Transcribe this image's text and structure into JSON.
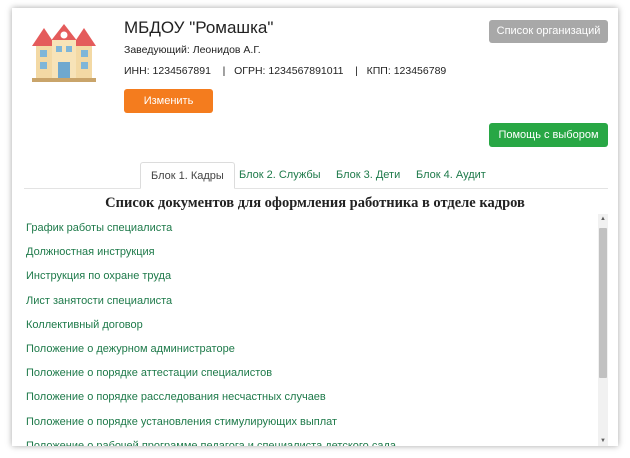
{
  "org": {
    "name": "МБДОУ \"Ромашка\"",
    "director": "Заведующий: Леонидов А.Г.",
    "ids": "ИНН: 1234567891    |   ОГРН: 1234567891011    |   КПП: 123456789"
  },
  "buttons": {
    "edit": "Изменить",
    "org_list": "Список организаций",
    "help": "Помощь с выбором"
  },
  "tabs": [
    "Блок 1. Кадры",
    "Блок 2. Службы",
    "Блок 3. Дети",
    "Блок 4. Аудит"
  ],
  "active_tab": "Блок 1. Кадры",
  "list_title": "Список документов для оформления работника в отделе кадров",
  "documents": [
    "График работы специалиста",
    "Должностная инструкция",
    "Инструкция по охране труда",
    "Лист занятости специалиста",
    "Коллективный договор",
    "Положение о дежурном администраторе",
    "Положение о порядке аттестации специалистов",
    "Положение о порядке расследования несчастных случаев",
    "Положение о порядке установления стимулирующих выплат",
    "Положение о рабочей программе педагога и специалиста детского сада"
  ],
  "icons": {
    "logo": "building-icon",
    "scroll_up": "▲",
    "scroll_down": "▼"
  },
  "colors": {
    "edit_button": "#f47c1e",
    "org_list_button": "#a8a8a8",
    "help_button": "#28a745",
    "link": "#1e7a4a"
  }
}
